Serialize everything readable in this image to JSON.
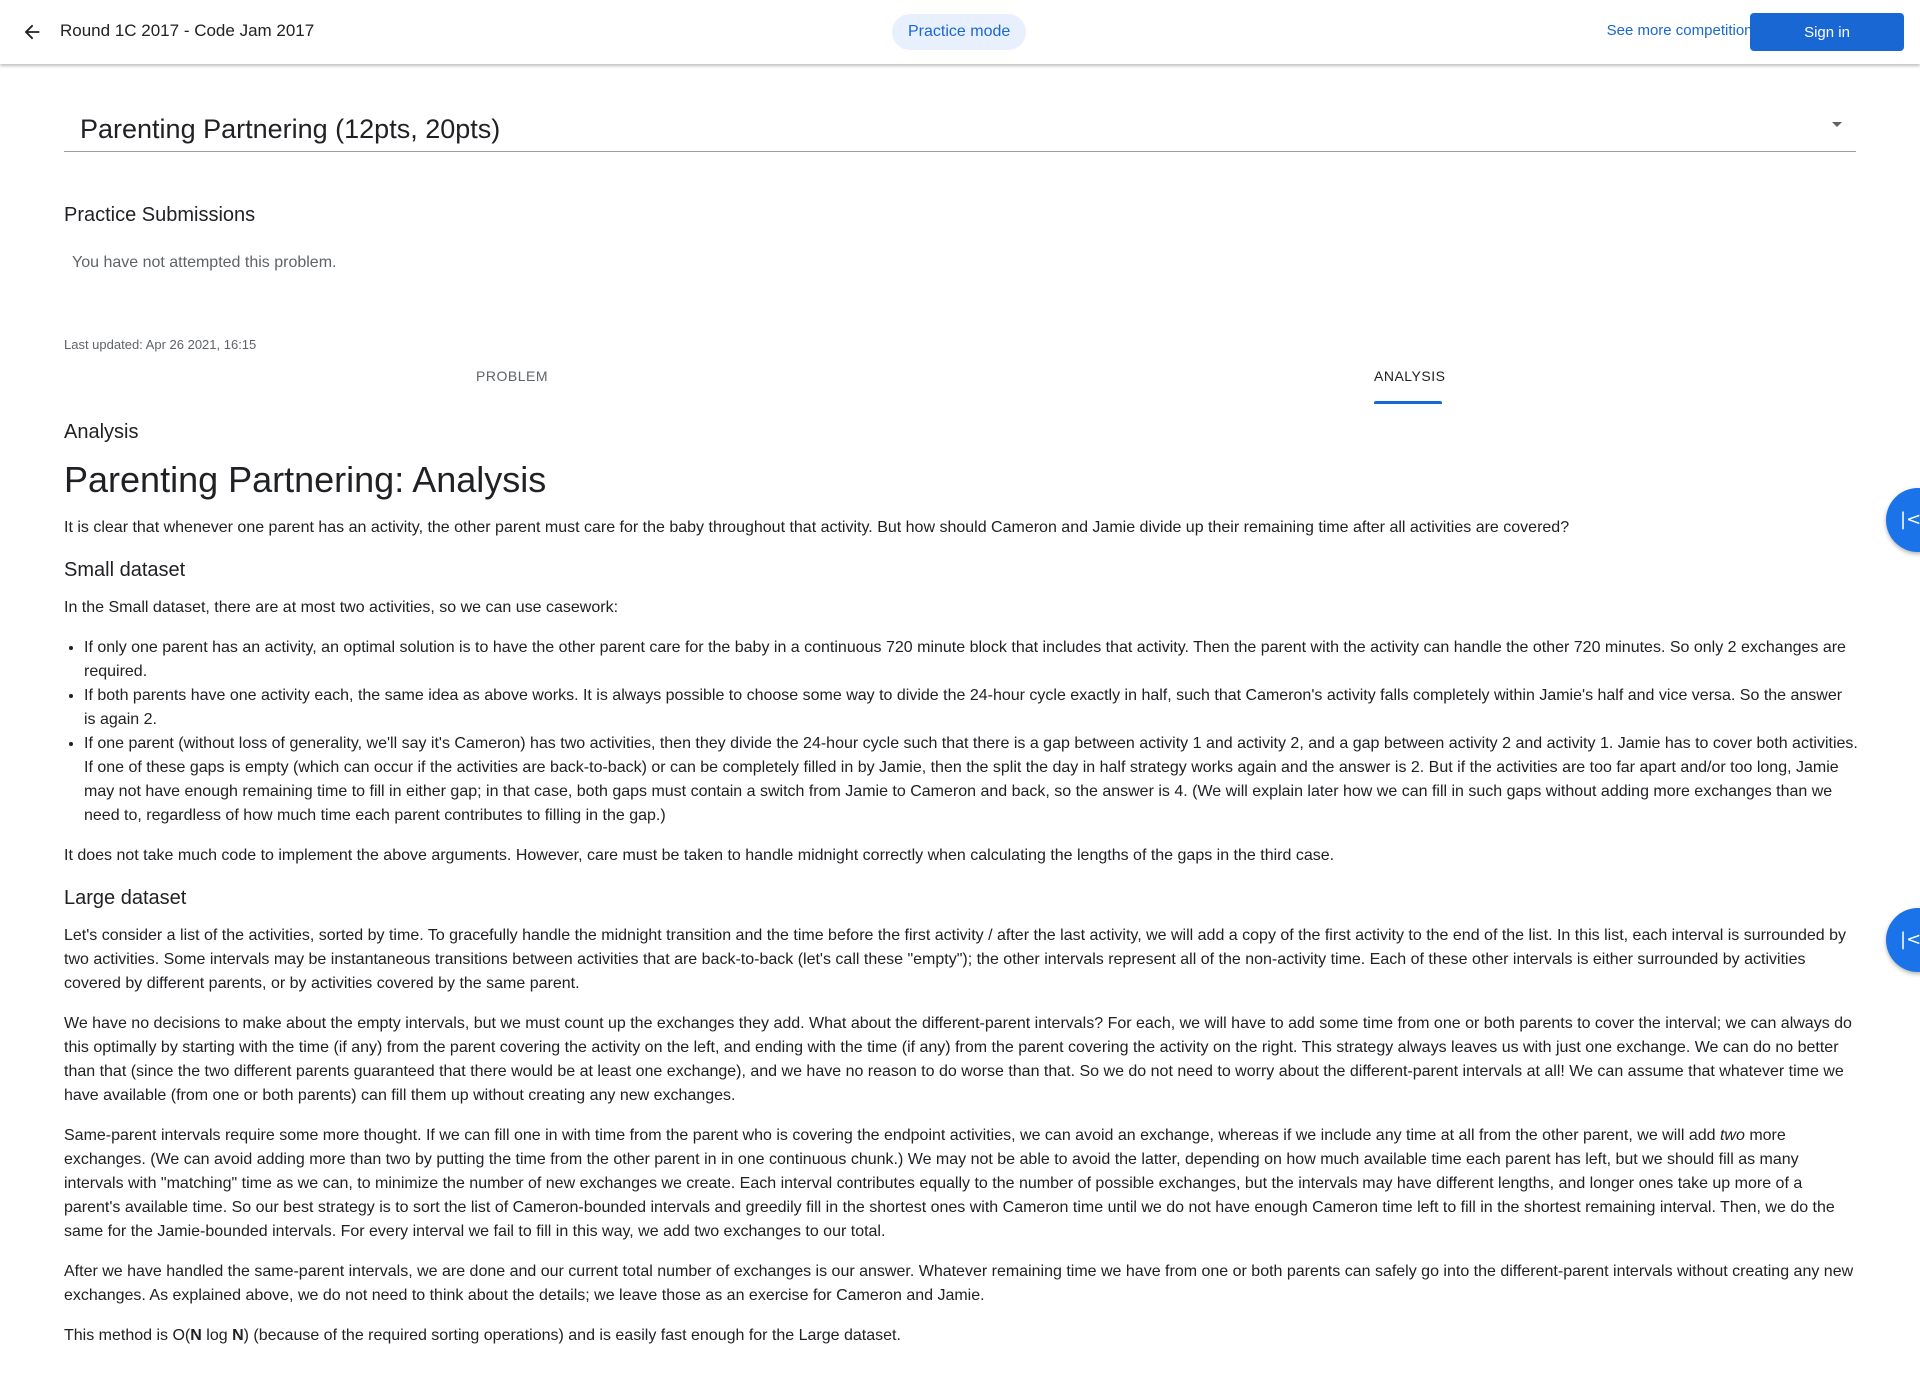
{
  "header": {
    "title": "Round 1C 2017 - Code Jam 2017",
    "practice_mode": "Practice mode",
    "see_more": "See more competitions",
    "sign_in": "Sign in"
  },
  "problem_select": {
    "label": "Parenting Partnering (12pts, 20pts)"
  },
  "submissions": {
    "title": "Practice Submissions",
    "empty": "You have not attempted this problem."
  },
  "last_updated": "Last updated: Apr 26 2021, 16:15",
  "tabs": [
    {
      "label": "PROBLEM"
    },
    {
      "label": "ANALYSIS"
    }
  ],
  "analysis": {
    "section_label": "Analysis",
    "title": "Parenting Partnering: Analysis",
    "intro": "It is clear that whenever one parent has an activity, the other parent must care for the baby throughout that activity. But how should Cameron and Jamie divide up their remaining time after all activities are covered?",
    "small_heading": "Small dataset",
    "small_intro": "In the Small dataset, there are at most two activities, so we can use casework:",
    "small_items": [
      "If only one parent has an activity, an optimal solution is to have the other parent care for the baby in a continuous 720 minute block that includes that activity. Then the parent with the activity can handle the other 720 minutes. So only 2 exchanges are required.",
      "If both parents have one activity each, the same idea as above works. It is always possible to choose some way to divide the 24-hour cycle exactly in half, such that Cameron's activity falls completely within Jamie's half and vice versa. So the answer is again 2.",
      "If one parent (without loss of generality, we'll say it's Cameron) has two activities, then they divide the 24-hour cycle such that there is a gap between activity 1 and activity 2, and a gap between activity 2 and activity 1. Jamie has to cover both activities. If one of these gaps is empty (which can occur if the activities are back-to-back) or can be completely filled in by Jamie, then the split the day in half strategy works again and the answer is 2. But if the activities are too far apart and/or too long, Jamie may not have enough remaining time to fill in either gap; in that case, both gaps must contain a switch from Jamie to Cameron and back, so the answer is 4. (We will explain later how we can fill in such gaps without adding more exchanges than we need to, regardless of how much time each parent contributes to filling in the gap.)"
    ],
    "small_outro": "It does not take much code to implement the above arguments. However, care must be taken to handle midnight correctly when calculating the lengths of the gaps in the third case.",
    "large_heading": "Large dataset",
    "large_p1": "Let's consider a list of the activities, sorted by time. To gracefully handle the midnight transition and the time before the first activity / after the last activity, we will add a copy of the first activity to the end of the list. In this list, each interval is surrounded by two activities. Some intervals may be instantaneous transitions between activities that are back-to-back (let's call these \"empty\"); the other intervals represent all of the non-activity time. Each of these other intervals is either surrounded by activities covered by different parents, or by activities covered by the same parent.",
    "large_p2": "We have no decisions to make about the empty intervals, but we must count up the exchanges they add. What about the different-parent intervals? For each, we will have to add some time from one or both parents to cover the interval; we can always do this optimally by starting with the time (if any) from the parent covering the activity on the left, and ending with the time (if any) from the parent covering the activity on the right. This strategy always leaves us with just one exchange. We can do no better than that (since the two different parents guaranteed that there would be at least one exchange), and we have no reason to do worse than that. So we do not need to worry about the different-parent intervals at all! We can assume that whatever time we have available (from one or both parents) can fill them up without creating any new exchanges.",
    "large_p3_a": "Same-parent intervals require some more thought. If we can fill one in with time from the parent who is covering the endpoint activities, we can avoid an exchange, whereas if we include any time at all from the other parent, we will add ",
    "large_p3_em": "two",
    "large_p3_b": " more exchanges. (We can avoid adding more than two by putting the time from the other parent in in one continuous chunk.) We may not be able to avoid the latter, depending on how much available time each parent has left, but we should fill as many intervals with \"matching\" time as we can, to minimize the number of new exchanges we create. Each interval contributes equally to the number of possible exchanges, but the intervals may have different lengths, and longer ones take up more of a parent's available time. So our best strategy is to sort the list of Cameron-bounded intervals and greedily fill in the shortest ones with Cameron time until we do not have enough Cameron time left to fill in the shortest remaining interval. Then, we do the same for the Jamie-bounded intervals. For every interval we fail to fill in this way, we add two exchanges to our total.",
    "large_p4": "After we have handled the same-parent intervals, we are done and our current total number of exchanges is our answer. Whatever remaining time we have from one or both parents can safely go into the different-parent intervals without creating any new exchanges. As explained above, we do not need to think about the details; we leave those as an exercise for Cameron and Jamie.",
    "complexity_a": "This method is O(",
    "complexity_n1": "N",
    "complexity_mid": " log ",
    "complexity_n2": "N",
    "complexity_b": ") (because of the required sorting operations) and is easily fast enough for the Large dataset."
  },
  "side_buttons": [
    {
      "icon": "collapse-left-icon",
      "glyph": "|<"
    },
    {
      "icon": "collapse-left-icon",
      "glyph": "|<"
    }
  ],
  "colors": {
    "accent": "#1967d2",
    "chip_bg": "#e8f0fe",
    "text": "#202124",
    "muted": "#5f6368"
  }
}
